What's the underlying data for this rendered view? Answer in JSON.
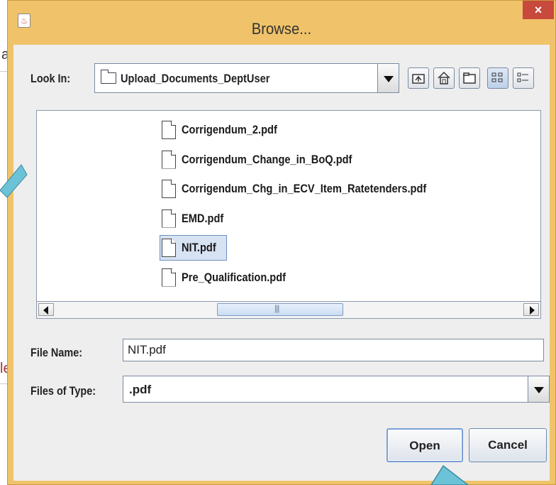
{
  "window": {
    "title": "Browse...",
    "close_label": "×",
    "app_icon_glyph": "♨"
  },
  "background": {
    "partial_text_top": "a",
    "partial_text_bottom": "le"
  },
  "look_in": {
    "label": "Look In:",
    "value": "Upload_Documents_DeptUser"
  },
  "toolbar": {
    "buttons": [
      "up-one-level",
      "home",
      "new-folder",
      "list-view",
      "details-view"
    ]
  },
  "files": [
    {
      "name": "Corrigendum_2.pdf",
      "selected": false
    },
    {
      "name": "Corrigendum_Change_in_BoQ.pdf",
      "selected": false
    },
    {
      "name": "Corrigendum_Chg_in_ECV_Item_Ratetenders.pdf",
      "selected": false
    },
    {
      "name": "EMD.pdf",
      "selected": false
    },
    {
      "name": "NIT.pdf",
      "selected": true
    },
    {
      "name": "Pre_Qualification.pdf",
      "selected": false
    }
  ],
  "file_name": {
    "label": "File Name:",
    "value": "NIT.pdf"
  },
  "file_type": {
    "label": "Files of Type:",
    "value": ".pdf"
  },
  "buttons": {
    "open": "Open",
    "cancel": "Cancel"
  },
  "colors": {
    "titlebar": "#f0c36a",
    "close": "#c84a3c",
    "selection": "#d7e3f3",
    "callout_arrow": "#6cc3d8"
  }
}
